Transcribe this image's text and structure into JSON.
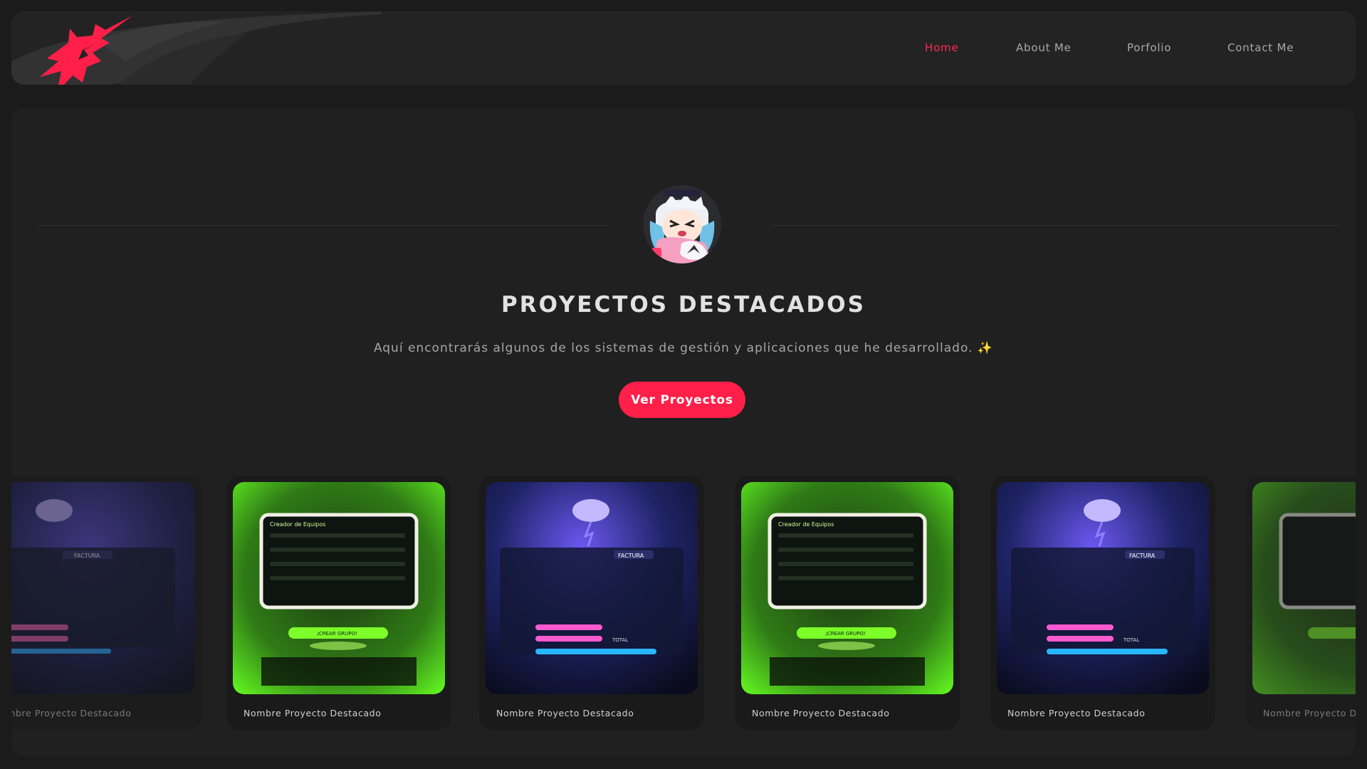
{
  "nav": {
    "items": [
      {
        "label": "Home",
        "active": true
      },
      {
        "label": "About Me",
        "active": false
      },
      {
        "label": "Porfolio",
        "active": false
      },
      {
        "label": "Contact Me",
        "active": false
      }
    ]
  },
  "hero": {
    "title": "PROYECTOS DESTACADOS",
    "subtitle": "Aquí encontrarás algunos de los sistemas de gestión y aplicaciones que he desarrollado.",
    "subtitle_emoji": "✨",
    "cta_label": "Ver Proyectos"
  },
  "projects": [
    {
      "name": "Nombre Proyecto Destacado",
      "theme": "purple"
    },
    {
      "name": "Nombre Proyecto Destacado",
      "theme": "green"
    },
    {
      "name": "Nombre Proyecto Destacado",
      "theme": "purple"
    },
    {
      "name": "Nombre Proyecto Destacado",
      "theme": "green"
    },
    {
      "name": "Nombre Proyecto Destacado",
      "theme": "purple"
    },
    {
      "name": "Nombre Proyecto Destacado",
      "theme": "green"
    }
  ],
  "thumbs": {
    "green_panel_title": "Creador de Equipos",
    "green_button": "¡CREAR GRUPO!",
    "purple_badge": "FACTURA",
    "purple_total": "TOTAL"
  },
  "colors": {
    "accent": "#ff1f48",
    "background": "#1b1b1c",
    "panel": "#202021",
    "header": "#232324"
  }
}
